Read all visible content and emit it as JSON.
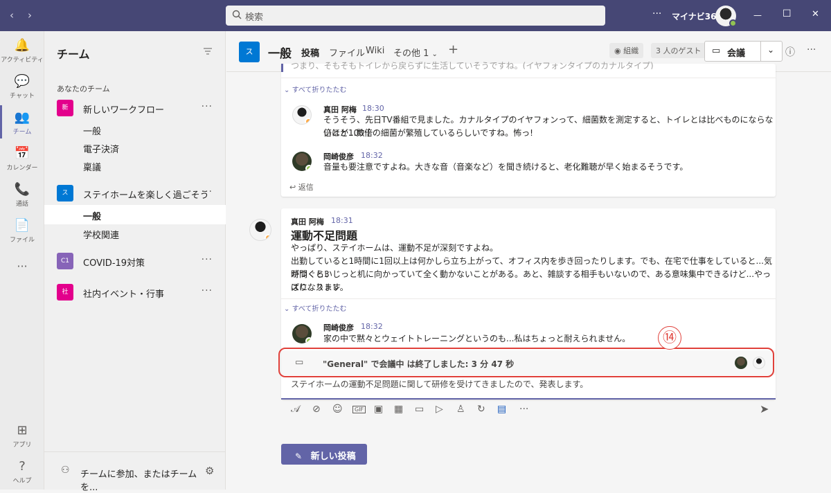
{
  "titlebar": {
    "back_glyph": "‹",
    "forward_glyph": "›",
    "search_placeholder": "検索",
    "more_glyph": "···",
    "org_name": "マイナビ365",
    "minimize": "—",
    "maximize": "☐",
    "close": "✕"
  },
  "rail": {
    "items": [
      {
        "label": "アクティビティ",
        "icon": "bell-icon",
        "glyph": "🔔"
      },
      {
        "label": "チャット",
        "icon": "chat-icon",
        "glyph": "💬"
      },
      {
        "label": "チーム",
        "icon": "teams-icon",
        "glyph": "👥"
      },
      {
        "label": "カレンダー",
        "icon": "calendar-icon",
        "glyph": "📅"
      },
      {
        "label": "通話",
        "icon": "phone-icon",
        "glyph": "📞"
      },
      {
        "label": "ファイル",
        "icon": "file-icon",
        "glyph": "📄"
      }
    ],
    "more": "···",
    "apps_label": "アプリ",
    "help_label": "ヘルプ"
  },
  "teampane": {
    "title": "チーム",
    "section_label": "あなたのチーム",
    "teams": [
      {
        "initial": "新",
        "name": "新しいワークフロー",
        "color": "#e3008c",
        "channels": [
          "一般",
          "電子決済",
          "稟議"
        ]
      },
      {
        "initial": "ス",
        "name": "ステイホームを楽しく過ごそう",
        "color": "#0078d4",
        "channels": [
          "一般",
          "学校関連"
        ]
      },
      {
        "initial": "C1",
        "name": "COVID-19対策",
        "color": "#8764b8",
        "channels": []
      },
      {
        "initial": "社",
        "name": "社内イベント・行事",
        "color": "#e3008c",
        "channels": []
      }
    ],
    "join_label": "チームに参加、またはチームを..."
  },
  "header": {
    "team_initial": "ス",
    "channel_name": "一般",
    "tabs": [
      "投稿",
      "ファイル",
      "Wiki",
      "その他 1"
    ],
    "add_tab": "+",
    "org_badge": "組織",
    "guests_badge": "3 人のゲスト",
    "meet_button": "会議",
    "info": "ⓘ",
    "more": "···"
  },
  "thread1": {
    "truncated_text": "つまり、そもそもトイレから戻らずに生活していそうですね。(イヤフォンタイプのカナルタイプ)",
    "collapse_label": "すべて折りたたむ",
    "replies": [
      {
        "author": "真田 阿梅",
        "time": "18:30",
        "lines": [
          "そうそう、先日TV番組で見ました。カナルタイプのイヤフォンって、細菌数を測定すると、トイレとは比べものにならないほど...数十",
          "倍とか100倍の細菌が繁殖しているらしいですね。怖っ!"
        ]
      },
      {
        "author": "岡崎俊彦",
        "time": "18:32",
        "lines": [
          "音量も要注意ですよね。大きな音（音楽など）を聞き続けると、老化難聴が早く始まるそうです。"
        ]
      }
    ],
    "reply_label": "返信"
  },
  "thread2": {
    "author": "真田 阿梅",
    "time": "18:31",
    "subject": "運動不足問題",
    "body": [
      "やっぱり、ステイホームは、運動不足が深刻ですよね。",
      "出勤していると1時間に1回以上は何かしら立ち上がって、オフィス内を歩き回ったりします。でも、在宅で仕事をしていると...気がつくと3",
      "時間ぐらいじっと机に向かっていて全く動かないことがある。あと、雑談する相手もいないので、ある意味集中できるけど...やっぱり、ストレ",
      "スになります。"
    ],
    "collapse_label": "すべて折りたたむ",
    "reply_author": "岡崎俊彦",
    "reply_time": "18:32",
    "reply_text": "家の中で黙々とウェイトトレーニングというのも...私はちょっと耐えられません。",
    "meeting_text": "\"General\" で会議中 は終了しました: 3 分 47 秒",
    "annotation": "⑭",
    "compose_text": "ステイホームの運動不足問題に関して研修を受けてきましたので、発表します。"
  },
  "new_post_label": "新しい投稿",
  "colors": {
    "brand": "#6264a7",
    "titlebar": "#464775",
    "highlight": "#e0403a"
  }
}
